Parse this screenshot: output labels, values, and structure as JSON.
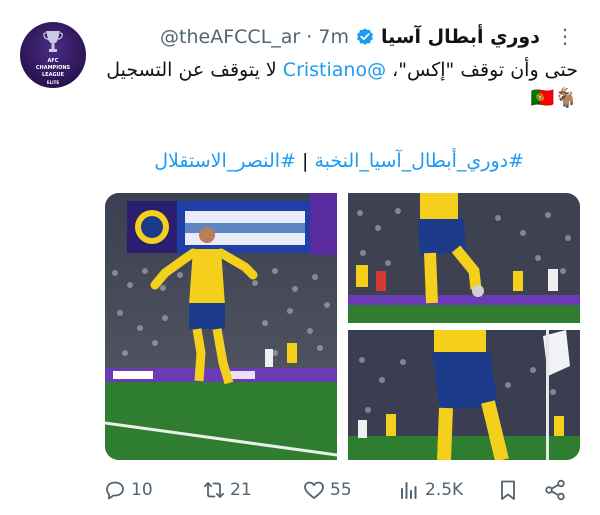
{
  "tweet": {
    "display_name": "دوري أبطال آسيا",
    "handle": "@theAFCCL_ar",
    "separator": "·",
    "time": "7m",
    "text_part1": "حتى وأن توقف \"إكس\"، ",
    "mention": "@Cristiano",
    "text_part2": " لا يتوقف عن التسجيل 🐐🇵🇹",
    "hashtags": [
      "#دوري_أبطال_آسيا_النخبة",
      "#النصر_الاستقلال"
    ],
    "hashtag_separator": " | "
  },
  "avatar": {
    "line1": "AFC",
    "line2": "CHAMPIONS",
    "line3": "LEAGUE",
    "line4": "ELITE"
  },
  "media": [
    {
      "icon": "soccer-celebration-photo",
      "caption": ""
    },
    {
      "icon": "player-legs-ball-photo",
      "caption": ""
    },
    {
      "icon": "player-closeup-photo",
      "caption": ""
    }
  ],
  "stats": {
    "replies": "10",
    "retweets": "21",
    "likes": "55",
    "views": "2.5K"
  },
  "colors": {
    "link": "#1d9bf0",
    "muted": "#536471",
    "verified": "#1d9bf0",
    "avatar_bg": "#2a1451",
    "pitch": "#2f7d31",
    "kit_yellow": "#f4d01c",
    "kit_blue": "#1c3b8a",
    "board_purple": "#6b3bb5"
  }
}
